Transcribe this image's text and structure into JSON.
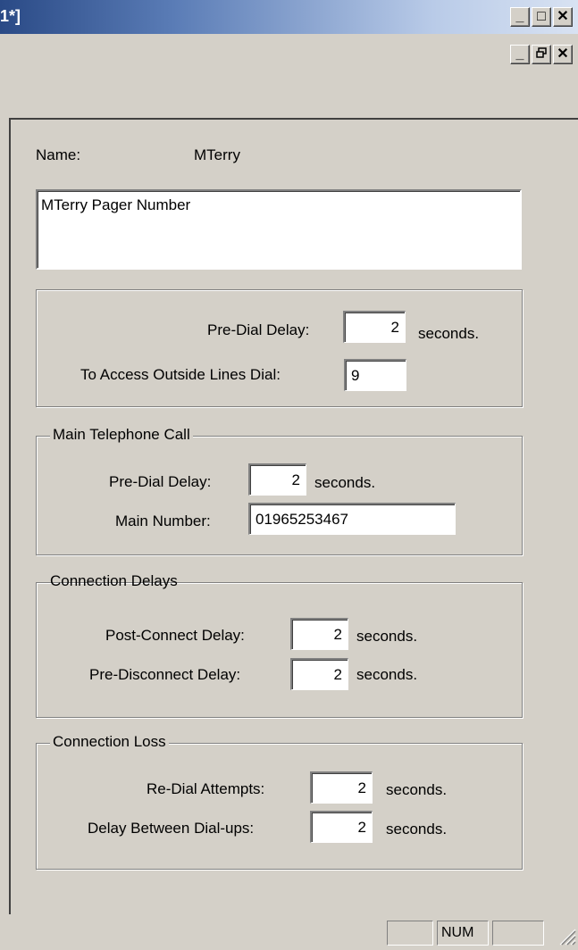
{
  "window": {
    "title": "1*]",
    "caption_minimize": "_",
    "caption_maximize": "□",
    "caption_close": "✕",
    "mdi_minimize": "_",
    "mdi_restore": "🗗",
    "mdi_close": "✕"
  },
  "form": {
    "name_label": "Name:",
    "name_value": "MTerry",
    "description": "MTerry Pager Number"
  },
  "dialing": {
    "pre_dial_label": "Pre-Dial Delay:",
    "pre_dial_value": "2",
    "pre_dial_unit": "seconds.",
    "outside_line_label": "To Access Outside Lines Dial:",
    "outside_line_value": "9"
  },
  "main_call": {
    "legend": "Main Telephone Call",
    "pre_dial_label": "Pre-Dial Delay:",
    "pre_dial_value": "2",
    "pre_dial_unit": "seconds.",
    "number_label": "Main Number:",
    "number_value": "01965253467"
  },
  "connection_delays": {
    "legend": "Connection Delays",
    "post_connect_label": "Post-Connect Delay:",
    "post_connect_value": "2",
    "post_connect_unit": "seconds.",
    "pre_disconnect_label": "Pre-Disconnect Delay:",
    "pre_disconnect_value": "2",
    "pre_disconnect_unit": "seconds."
  },
  "connection_loss": {
    "legend": "Connection Loss",
    "redial_label": "Re-Dial Attempts:",
    "redial_value": "2",
    "redial_unit": "seconds.",
    "between_label": "Delay Between Dial-ups:",
    "between_value": "2",
    "between_unit": "seconds."
  },
  "statusbar": {
    "num_indicator": "NUM"
  }
}
